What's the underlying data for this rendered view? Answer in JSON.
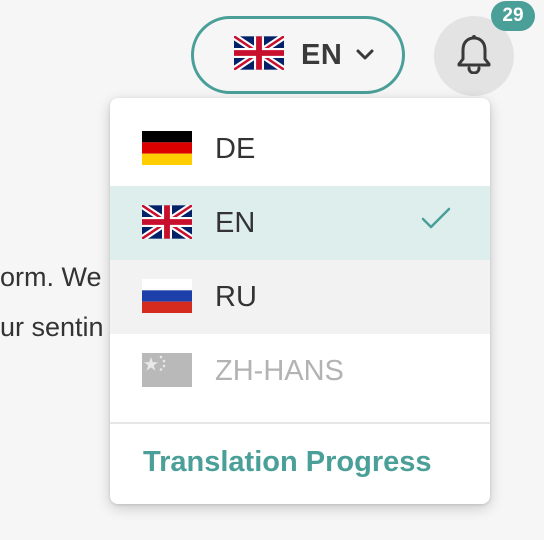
{
  "background": {
    "line1": "orm. We",
    "line2": "ur sentin"
  },
  "language_switcher": {
    "current_code": "EN",
    "current_flag": "uk-flag-icon"
  },
  "notifications": {
    "count": "29"
  },
  "dropdown": {
    "options": [
      {
        "code": "DE",
        "flag": "germany-flag-icon",
        "state": "normal"
      },
      {
        "code": "EN",
        "flag": "uk-flag-icon",
        "state": "selected"
      },
      {
        "code": "RU",
        "flag": "russia-flag-icon",
        "state": "hover"
      },
      {
        "code": "ZH-HANS",
        "flag": "china-flag-icon",
        "state": "disabled"
      }
    ],
    "footer_link": "Translation Progress"
  },
  "colors": {
    "accent": "#4a9f98",
    "selected_bg": "#ddeeed",
    "hover_bg": "#f2f2f2",
    "disabled_text": "#b3b3b3"
  }
}
